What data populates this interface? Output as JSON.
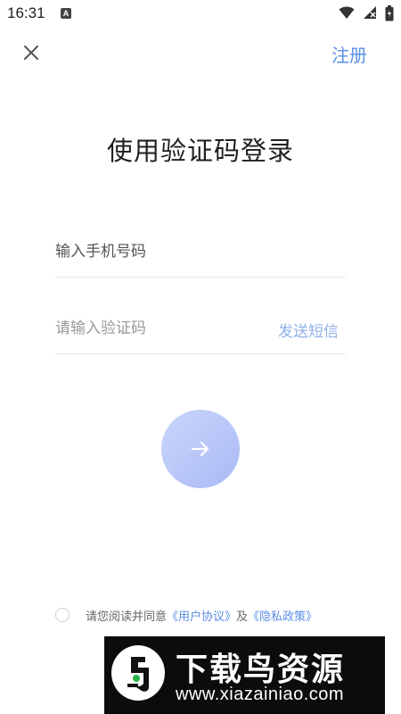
{
  "status_bar": {
    "time": "16:31",
    "notification_letter": "A",
    "icons": [
      "wifi-icon",
      "signal-icon",
      "battery-icon"
    ]
  },
  "header": {
    "close_icon": "close-icon",
    "register_label": "注册"
  },
  "title": "使用验证码登录",
  "form": {
    "phone_placeholder": "输入手机号码",
    "phone_value": "",
    "code_placeholder": "请输入验证码",
    "code_value": "",
    "send_sms_label": "发送短信",
    "submit_icon": "arrow-right-icon"
  },
  "agreement": {
    "checked": false,
    "prefix": "请您阅读并同意",
    "user_agreement": "《用户协议》",
    "connector": "及",
    "privacy_policy": "《隐私政策》"
  },
  "watermark": {
    "title": "下载鸟资源",
    "url": "www.xiazainiao.com"
  },
  "colors": {
    "accent": "#5b8ee6",
    "sms_link": "#8fb0e8",
    "button_start": "#c9d6fb",
    "button_end": "#aab9f6",
    "divider": "#e8e8e8"
  }
}
